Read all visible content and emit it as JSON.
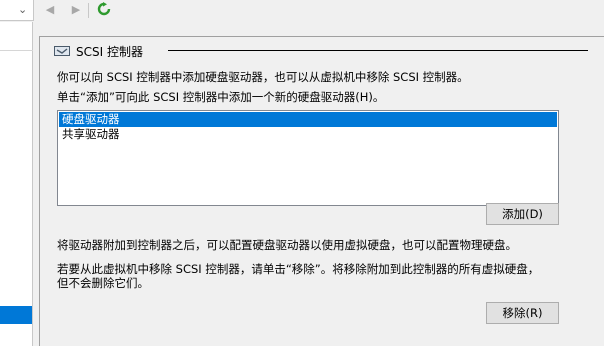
{
  "toolbar": {
    "dropdown_icon": "chevron-down-icon",
    "back_icon": "back-arrow-icon",
    "forward_icon": "forward-arrow-icon",
    "refresh_icon": "refresh-icon"
  },
  "group": {
    "title": "SCSI 控制器",
    "icon": "scsi-controller-icon"
  },
  "text": {
    "intro": "你可以向 SCSI 控制器中添加硬盘驱动器，也可以从虚拟机中移除 SCSI 控制器。",
    "instruction": "单击“添加”可向此 SCSI 控制器中添加一个新的硬盘驱动器(H)。",
    "after_attach": "将驱动器附加到控制器之后，可以配置硬盘驱动器以使用虚拟硬盘，也可以配置物理硬盘。",
    "remove_note_line1": "若要从此虚拟机中移除 SCSI 控制器，请单击“移除”。将移除附加到此控制器的所有虚拟硬盘，",
    "remove_note_line2": "但不会删除它们。"
  },
  "list": {
    "items": [
      "硬盘驱动器",
      "共享驱动器"
    ],
    "selected": "硬盘驱动器"
  },
  "buttons": {
    "add": "添加(D)",
    "remove": "移除(R)"
  },
  "colors": {
    "selection": "#0078d7",
    "refresh_green": "#2e9a2e"
  }
}
